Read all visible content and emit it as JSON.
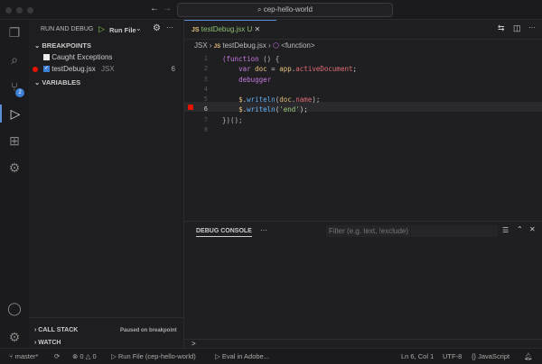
{
  "titlebar": {
    "search": "cep-hello-world",
    "back": "←",
    "forward": "→"
  },
  "sidebar": {
    "title": "RUN AND DEBUG",
    "config": "Run File",
    "breakpoints": {
      "header": "BREAKPOINTS",
      "items": [
        {
          "label": "Caught Exceptions",
          "checked": false
        },
        {
          "label": "testDebug.jsx",
          "folder": "JSX",
          "line": "6",
          "checked": true
        }
      ]
    },
    "variables": "VARIABLES",
    "call_stack": "CALL STACK",
    "call_stack_status": "Paused on breakpoint",
    "watch": "WATCH"
  },
  "activity": {
    "badge": "2"
  },
  "editor": {
    "tab": {
      "icon": "JS",
      "name": "testDebug.jsx",
      "status": "U"
    },
    "breadcrumb": [
      "JSX",
      "testDebug.jsx",
      "<function>"
    ],
    "line_numbers": [
      "1",
      "2",
      "3",
      "4",
      "5",
      "6",
      "7",
      "8"
    ],
    "breakpoint_line": 6
  },
  "panel": {
    "tab": "DEBUG CONSOLE",
    "filter_placeholder": "Filter (e.g. text, !exclude)",
    "prompt": ">"
  },
  "status": {
    "branch": "master*",
    "errors": "0",
    "warnings": "0",
    "run": "Run File (cep-hello-world)",
    "eval": "Eval in Adobe...",
    "position": "Ln 6, Col 1",
    "encoding": "UTF-8",
    "language": "JavaScript"
  },
  "colors": {
    "accent": "#5a8fd8",
    "breakpoint": "#e51400",
    "badge": "#3d7fd6"
  }
}
